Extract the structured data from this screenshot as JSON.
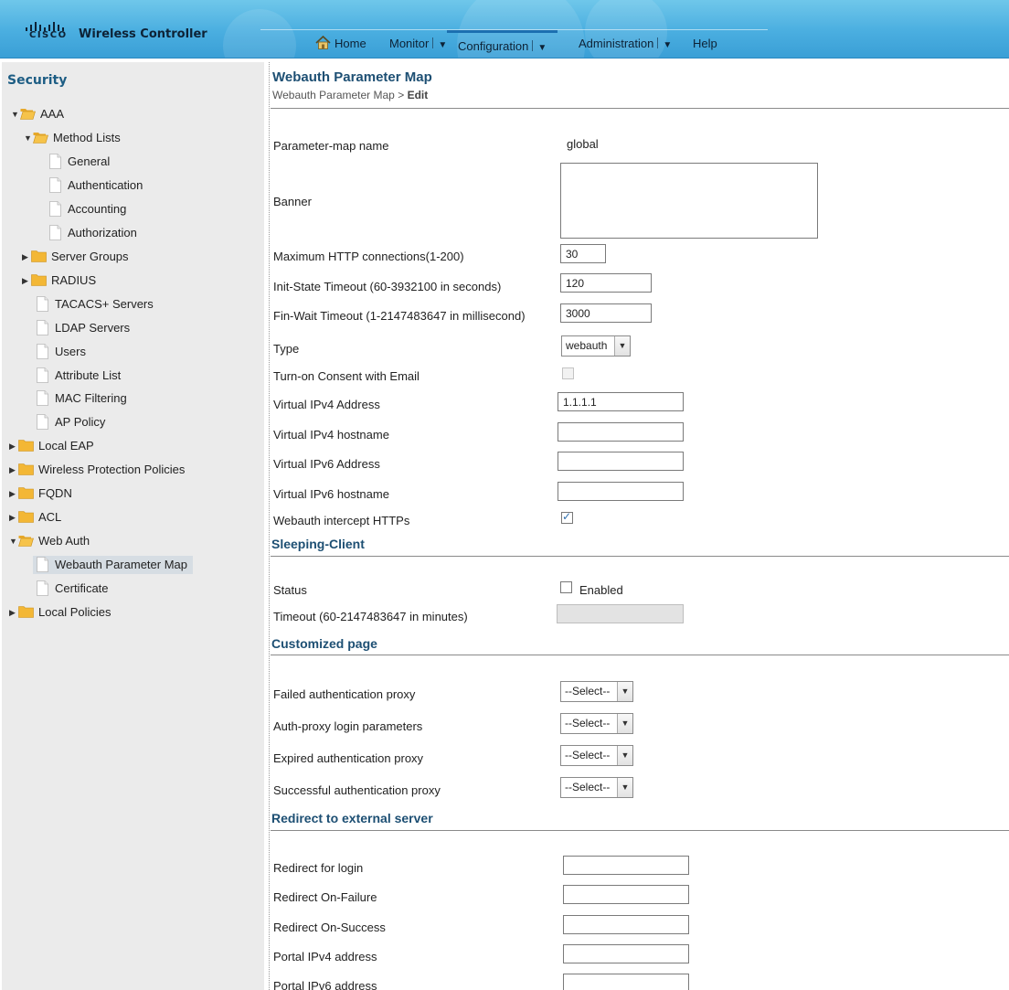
{
  "header": {
    "logo_text": "CISCO",
    "app_title": "Wireless Controller",
    "nav": [
      {
        "label": "Home",
        "icon": "home-icon"
      },
      {
        "label": "Monitor",
        "dropdown": true
      },
      {
        "label": "Configuration",
        "dropdown": true,
        "active": true
      },
      {
        "label": "Administration",
        "dropdown": true
      },
      {
        "label": "Help"
      }
    ]
  },
  "sidebar": {
    "title": "Security",
    "items": [
      {
        "label": "AAA",
        "type": "folder",
        "expanded": true
      },
      {
        "label": "Method Lists",
        "type": "folder",
        "expanded": true
      },
      {
        "label": "General",
        "type": "page"
      },
      {
        "label": "Authentication",
        "type": "page"
      },
      {
        "label": "Accounting",
        "type": "page"
      },
      {
        "label": "Authorization",
        "type": "page"
      },
      {
        "label": "Server Groups",
        "type": "folder",
        "expanded": false
      },
      {
        "label": "RADIUS",
        "type": "folder",
        "expanded": false
      },
      {
        "label": "TACACS+ Servers",
        "type": "page"
      },
      {
        "label": "LDAP Servers",
        "type": "page"
      },
      {
        "label": "Users",
        "type": "page"
      },
      {
        "label": "Attribute List",
        "type": "page"
      },
      {
        "label": "MAC Filtering",
        "type": "page"
      },
      {
        "label": "AP Policy",
        "type": "page"
      },
      {
        "label": "Local EAP",
        "type": "folder",
        "expanded": false
      },
      {
        "label": "Wireless Protection Policies",
        "type": "folder",
        "expanded": false
      },
      {
        "label": "FQDN",
        "type": "folder",
        "expanded": false
      },
      {
        "label": "ACL",
        "type": "folder",
        "expanded": false
      },
      {
        "label": "Web Auth",
        "type": "folder",
        "expanded": true
      },
      {
        "label": "Webauth Parameter Map",
        "type": "page",
        "selected": true
      },
      {
        "label": "Certificate",
        "type": "page"
      },
      {
        "label": "Local Policies",
        "type": "folder",
        "expanded": false
      }
    ]
  },
  "main": {
    "title": "Webauth Parameter Map",
    "breadcrumb": {
      "parent": "Webauth Parameter Map",
      "separator": ">",
      "current": "Edit"
    },
    "fields": {
      "param_map_name": {
        "label": "Parameter-map name",
        "value": "global"
      },
      "banner": {
        "label": "Banner",
        "value": ""
      },
      "max_http": {
        "label": "Maximum HTTP connections(1-200)",
        "value": "30"
      },
      "init_state": {
        "label": "Init-State Timeout (60-3932100 in seconds)",
        "value": "120"
      },
      "fin_wait": {
        "label": "Fin-Wait Timeout (1-2147483647 in millisecond)",
        "value": "3000"
      },
      "type": {
        "label": "Type",
        "value": "webauth"
      },
      "consent_email": {
        "label": "Turn-on Consent with Email",
        "checked": false
      },
      "v4_addr": {
        "label": "Virtual IPv4 Address",
        "value": "1.1.1.1"
      },
      "v4_host": {
        "label": "Virtual IPv4 hostname",
        "value": ""
      },
      "v6_addr": {
        "label": "Virtual IPv6 Address",
        "value": ""
      },
      "v6_host": {
        "label": "Virtual IPv6 hostname",
        "value": ""
      },
      "intercept_https": {
        "label": "Webauth intercept HTTPs",
        "checked": true
      }
    },
    "sleeping_client": {
      "title": "Sleeping-Client",
      "status_label": "Status",
      "status_checkbox_label": "Enabled",
      "status_checked": false,
      "timeout_label": "Timeout (60-2147483647 in minutes)",
      "timeout_value": ""
    },
    "customized_page": {
      "title": "Customized page",
      "rows": [
        {
          "label": "Failed authentication proxy",
          "value": "--Select--"
        },
        {
          "label": "Auth-proxy login parameters",
          "value": "--Select--"
        },
        {
          "label": "Expired authentication proxy",
          "value": "--Select--"
        },
        {
          "label": "Successful authentication proxy",
          "value": "--Select--"
        }
      ]
    },
    "redirect": {
      "title": "Redirect to external server",
      "rows": [
        {
          "label": "Redirect for login",
          "value": ""
        },
        {
          "label": "Redirect On-Failure",
          "value": ""
        },
        {
          "label": "Redirect On-Success",
          "value": ""
        },
        {
          "label": "Portal IPv4 address",
          "value": ""
        },
        {
          "label": "Portal IPv6 address",
          "value": ""
        }
      ]
    }
  },
  "colors": {
    "header_blue": "#4aaee0",
    "section_title": "#1d4f73",
    "sidebar_bg": "#ebebeb",
    "folder_yellow": "#f2b632"
  }
}
